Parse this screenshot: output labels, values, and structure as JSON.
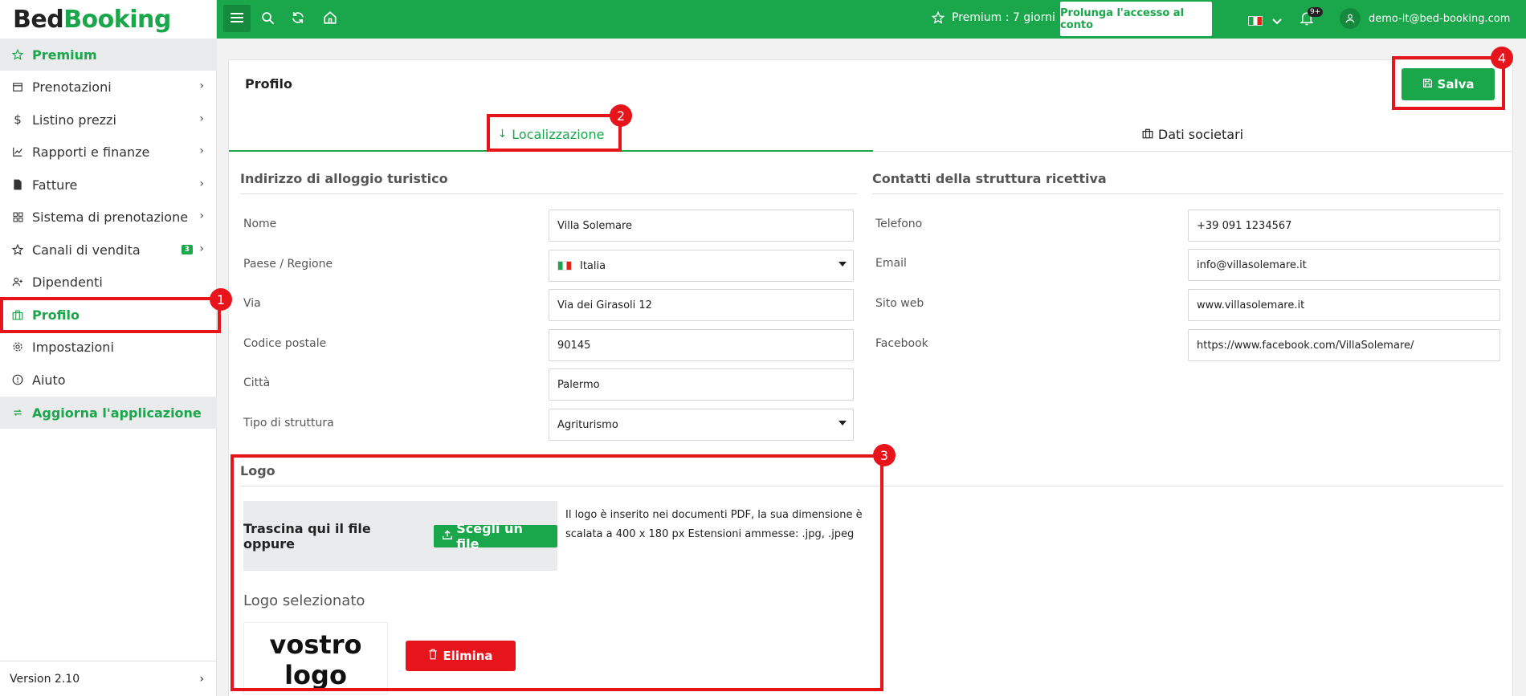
{
  "brand": {
    "part1": "Bed",
    "part2": "Booking"
  },
  "sidebar": {
    "items": [
      {
        "label": "Premium",
        "icon": "star-icon"
      },
      {
        "label": "Prenotazioni",
        "icon": "calendar-icon"
      },
      {
        "label": "Listino prezzi",
        "icon": "dollar-icon"
      },
      {
        "label": "Rapporti e finanze",
        "icon": "chart-icon"
      },
      {
        "label": "Fatture",
        "icon": "invoice-icon"
      },
      {
        "label": "Sistema di prenotazione",
        "icon": "grid-icon"
      },
      {
        "label": "Canali di vendita",
        "icon": "star-icon",
        "badge": "3"
      },
      {
        "label": "Dipendenti",
        "icon": "user-add-icon"
      },
      {
        "label": "Profilo",
        "icon": "briefcase-icon"
      },
      {
        "label": "Impostazioni",
        "icon": "gear-icon"
      },
      {
        "label": "Aiuto",
        "icon": "info-icon"
      },
      {
        "label": "Aggiorna l'applicazione",
        "icon": "refresh-icon"
      }
    ],
    "version": "Version 2.10"
  },
  "topbar": {
    "premium_text": "Premium : 7 giorni",
    "extend_button": "Prolunga l'accesso al conto",
    "notif_count": "9+",
    "user_email": "demo-it@bed-booking.com"
  },
  "profile": {
    "title": "Profilo",
    "save_label": "Salva",
    "tabs": [
      "Localizzazione",
      "Dati societari"
    ]
  },
  "address_section": {
    "heading": "Indirizzo di alloggio turistico",
    "fields": [
      {
        "label": "Nome",
        "value": "Villa Solemare"
      },
      {
        "label": "Paese / Regione",
        "value": "Italia"
      },
      {
        "label": "Via",
        "value": "Via dei Girasoli 12"
      },
      {
        "label": "Codice postale",
        "value": "90145"
      },
      {
        "label": "Città",
        "value": "Palermo"
      },
      {
        "label": "Tipo di struttura",
        "value": "Agriturismo"
      }
    ]
  },
  "contacts_section": {
    "heading": "Contatti della struttura ricettiva",
    "fields": [
      {
        "label": "Telefono",
        "value": "+39 091 1234567"
      },
      {
        "label": "Email",
        "value": "info@villasolemare.it"
      },
      {
        "label": "Sito web",
        "value": "www.villasolemare.it"
      },
      {
        "label": "Facebook",
        "value": "https://www.facebook.com/VillaSolemare/"
      }
    ]
  },
  "logo_section": {
    "heading": "Logo",
    "drop_text": "Trascina qui il file oppure",
    "choose_label": "Scegli un file",
    "info": "Il logo è inserito nei documenti PDF, la sua dimensione è scalata a 400 x 180 px Estensioni ammesse: .jpg, .jpeg",
    "selected_label": "Logo selezionato",
    "preview_line1": "vostro",
    "preview_line2": "logo",
    "delete_label": "Elimina"
  },
  "annotations": [
    "1",
    "2",
    "3",
    "4"
  ],
  "colors": {
    "brand_green": "#1aa64a",
    "danger_red": "#e8141c"
  }
}
